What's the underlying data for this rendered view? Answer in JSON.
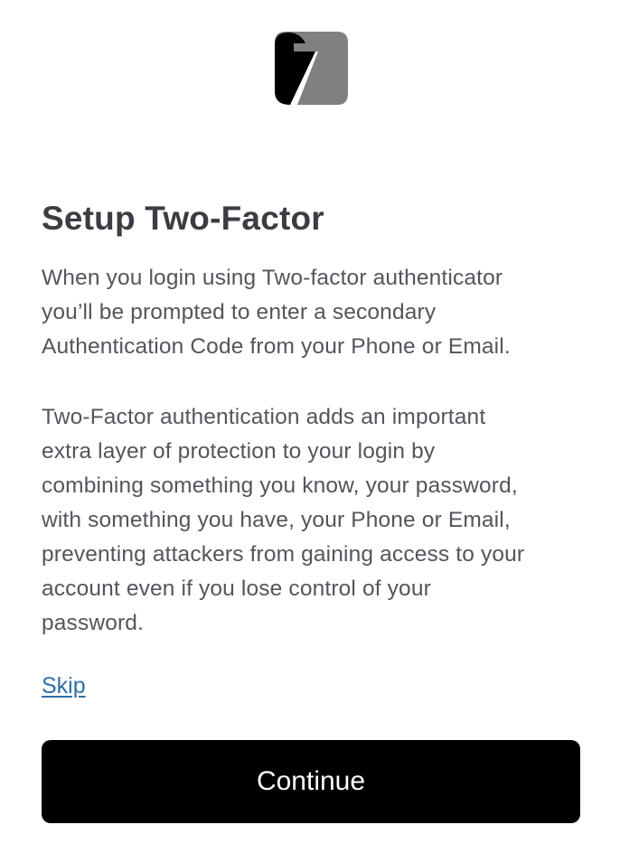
{
  "logo": {
    "icon": "brand-logo-icon",
    "colors": {
      "dark": "#000000",
      "light": "#808080"
    }
  },
  "header": {
    "title": "Setup Two-Factor"
  },
  "body": {
    "paragraph1": [
      "When you login using Two-factor authenticator",
      "you’ll be prompted to enter a secondary",
      "Authentication Code from your Phone or Email."
    ],
    "paragraph2": [
      "Two-Factor authentication adds an important",
      "extra layer of protection to your login by",
      "combining something you know, your password,",
      "with something you have, your Phone or Email,",
      "preventing attackers from gaining access to your",
      "account even if you lose control of your",
      "password."
    ]
  },
  "actions": {
    "skip_label": "Skip",
    "continue_label": "Continue",
    "link_color": "#2f6fa8",
    "button_color": "#000000"
  }
}
